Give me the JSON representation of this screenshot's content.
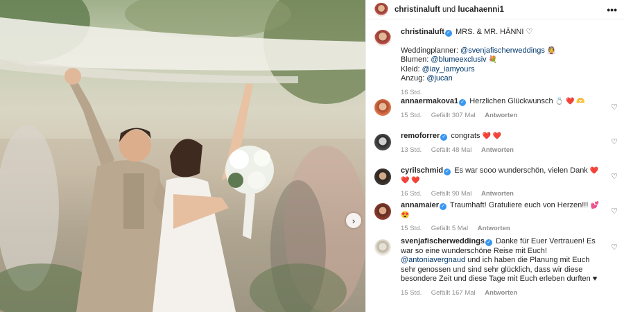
{
  "header": {
    "user1": "christinaluft",
    "separator": "und",
    "user2": "lucahaenni1",
    "more_icon": "•••"
  },
  "caption": {
    "username": "christinaluft",
    "text": "MRS. & MR. HÄNNI ♡",
    "planner_label": "Weddingplanner:",
    "planner_mention": "@svenjafischerweddings",
    "flowers_label": "Blumen:",
    "flowers_mention": "@blumeexclusiv",
    "dress_label": "Kleid:",
    "dress_mention": "@iay_iamyours",
    "suit_label": "Anzug:",
    "suit_mention": "@jucan",
    "time": "16 Std."
  },
  "comments": [
    {
      "username": "annaermakova1",
      "text": "Herzlichen Glückwunsch",
      "emojis": "💍 ❤️ 🫶",
      "time": "15 Std.",
      "likes": "Gefällt 307 Mal",
      "reply": "Antworten"
    },
    {
      "username": "remoforrer",
      "text": "congrats",
      "emojis": "❤️ ❤️",
      "time": "13 Std.",
      "likes": "Gefällt 48 Mal",
      "reply": "Antworten"
    },
    {
      "username": "cyrilschmid",
      "text": "Es war sooo wunderschön, vielen Dank",
      "emojis": "❤️ ❤️ ❤️",
      "time": "16 Std.",
      "likes": "Gefällt 90 Mal",
      "reply": "Antworten"
    },
    {
      "username": "annamaier",
      "text": "Traumhaft! Gratuliere euch von Herzen!!!",
      "emojis": "💕 😍",
      "time": "15 Std.",
      "likes": "Gefällt 5 Mal",
      "reply": "Antworten"
    },
    {
      "username": "svenjafischerweddings",
      "text_before": "Danke für Euer Vertrauen! Es war so eine wunderschöne Reise mit Euch!",
      "mention": "@antoniavergnaud",
      "text_after": "und ich haben die Planung mit Euch sehr genossen und sind sehr glücklich, dass wir diese besondere Zeit und diese Tage mit Euch erleben durften ♥",
      "time": "15 Std.",
      "likes": "Gefällt 167 Mal",
      "reply": "Antworten"
    }
  ],
  "icons": {
    "verified": "verified-badge",
    "like": "heart-outline",
    "next": "chevron-right"
  },
  "colors": {
    "verified": "#3897f0",
    "mention": "#00376b",
    "meta": "#8e8e8e"
  }
}
